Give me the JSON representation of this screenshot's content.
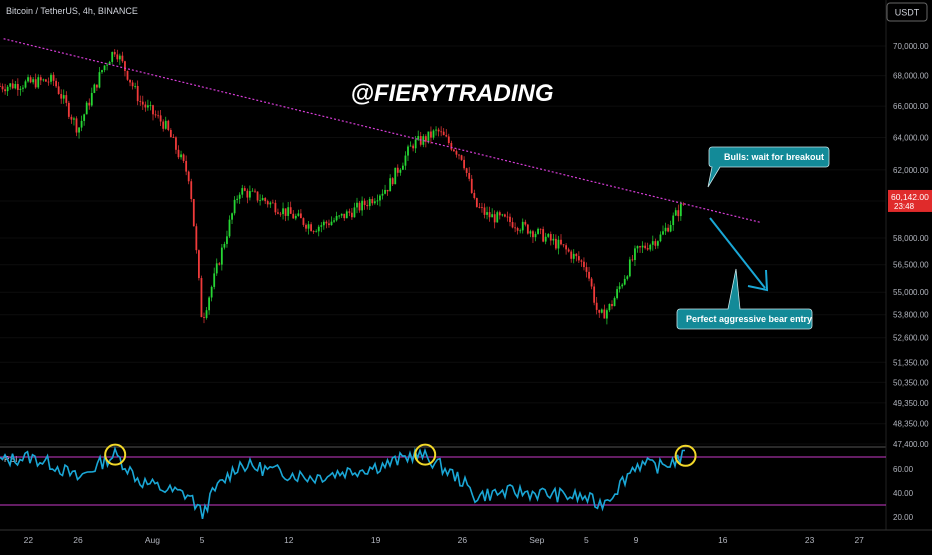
{
  "header": {
    "symbol_title": "Bitcoin / TetherUS, 4h, BINANCE",
    "currency": "USDT"
  },
  "watermark": "@FIERYTRADING",
  "price_axis": {
    "ticks": [
      "70,000.00",
      "68,000.00",
      "66,000.00",
      "64,000.00",
      "62,000.00",
      "60,142.00",
      "58,000.00",
      "56,500.00",
      "55,000.00",
      "53,800.00",
      "52,600.00",
      "51,350.00",
      "50,350.00",
      "49,350.00",
      "48,350.00",
      "47,400.00"
    ],
    "current_price_label": "60,142.00",
    "countdown_label": "23:48"
  },
  "time_axis": {
    "ticks": [
      "22",
      "26",
      "Aug",
      "5",
      "12",
      "19",
      "26",
      "Sep",
      "5",
      "9",
      "16",
      "23",
      "27"
    ]
  },
  "annotations": {
    "bulls_note": "Bulls: wait for breakout",
    "bear_note": "Perfect aggressive bear entry"
  },
  "rsi_panel": {
    "label": "RSI",
    "ticks": [
      "60.00",
      "40.00",
      "20.00"
    ],
    "upper_band": 70,
    "lower_band": 30
  },
  "colors": {
    "up": "#26d634",
    "down": "#ef3a3a",
    "trendline": "#d63cd6",
    "rsi_line": "#1aa7d6",
    "band": "#c83ac8",
    "callout_bg": "#138a98",
    "arrow": "#1aa7d6",
    "highlight_circle": "#f2d829",
    "price_tag": "#e02b2b"
  },
  "chart_data": {
    "type": "candlestick",
    "symbol": "Bitcoin / TetherUS",
    "interval": "4h",
    "x": [
      "Jul 20",
      "Jul 22",
      "Jul 24",
      "Jul 26",
      "Jul 28",
      "Jul 29",
      "Jul 31",
      "Aug 2",
      "Aug 4",
      "Aug 5",
      "Aug 6",
      "Aug 8",
      "Aug 10",
      "Aug 12",
      "Aug 14",
      "Aug 16",
      "Aug 18",
      "Aug 20",
      "Aug 22",
      "Aug 23",
      "Aug 24",
      "Aug 26",
      "Aug 27",
      "Aug 28",
      "Aug 30",
      "Sep 1",
      "Sep 3",
      "Sep 5",
      "Sep 6",
      "Sep 7",
      "Sep 9",
      "Sep 11",
      "Sep 13"
    ],
    "close": [
      67300,
      67500,
      67700,
      64500,
      68500,
      69800,
      66300,
      64800,
      61500,
      53500,
      55800,
      60800,
      60200,
      59400,
      58600,
      59100,
      59900,
      61000,
      63600,
      63900,
      64400,
      62800,
      59900,
      59300,
      58900,
      58300,
      57500,
      56400,
      53600,
      54300,
      57200,
      58100,
      60142
    ],
    "trendline": {
      "from": {
        "x": "Jul 20",
        "y": 70500
      },
      "to": {
        "x": "Sep 19",
        "y": 58900
      }
    },
    "rsi": [
      67,
      70,
      64,
      52,
      66,
      72,
      50,
      43,
      38,
      22,
      42,
      64,
      60,
      56,
      53,
      57,
      60,
      64,
      72,
      70,
      64,
      50,
      37,
      39,
      41,
      40,
      38,
      36,
      30,
      38,
      64,
      62,
      71
    ],
    "rsi_bands": [
      70,
      30
    ],
    "y_scale": "log",
    "ylim": [
      47400,
      71000
    ]
  }
}
